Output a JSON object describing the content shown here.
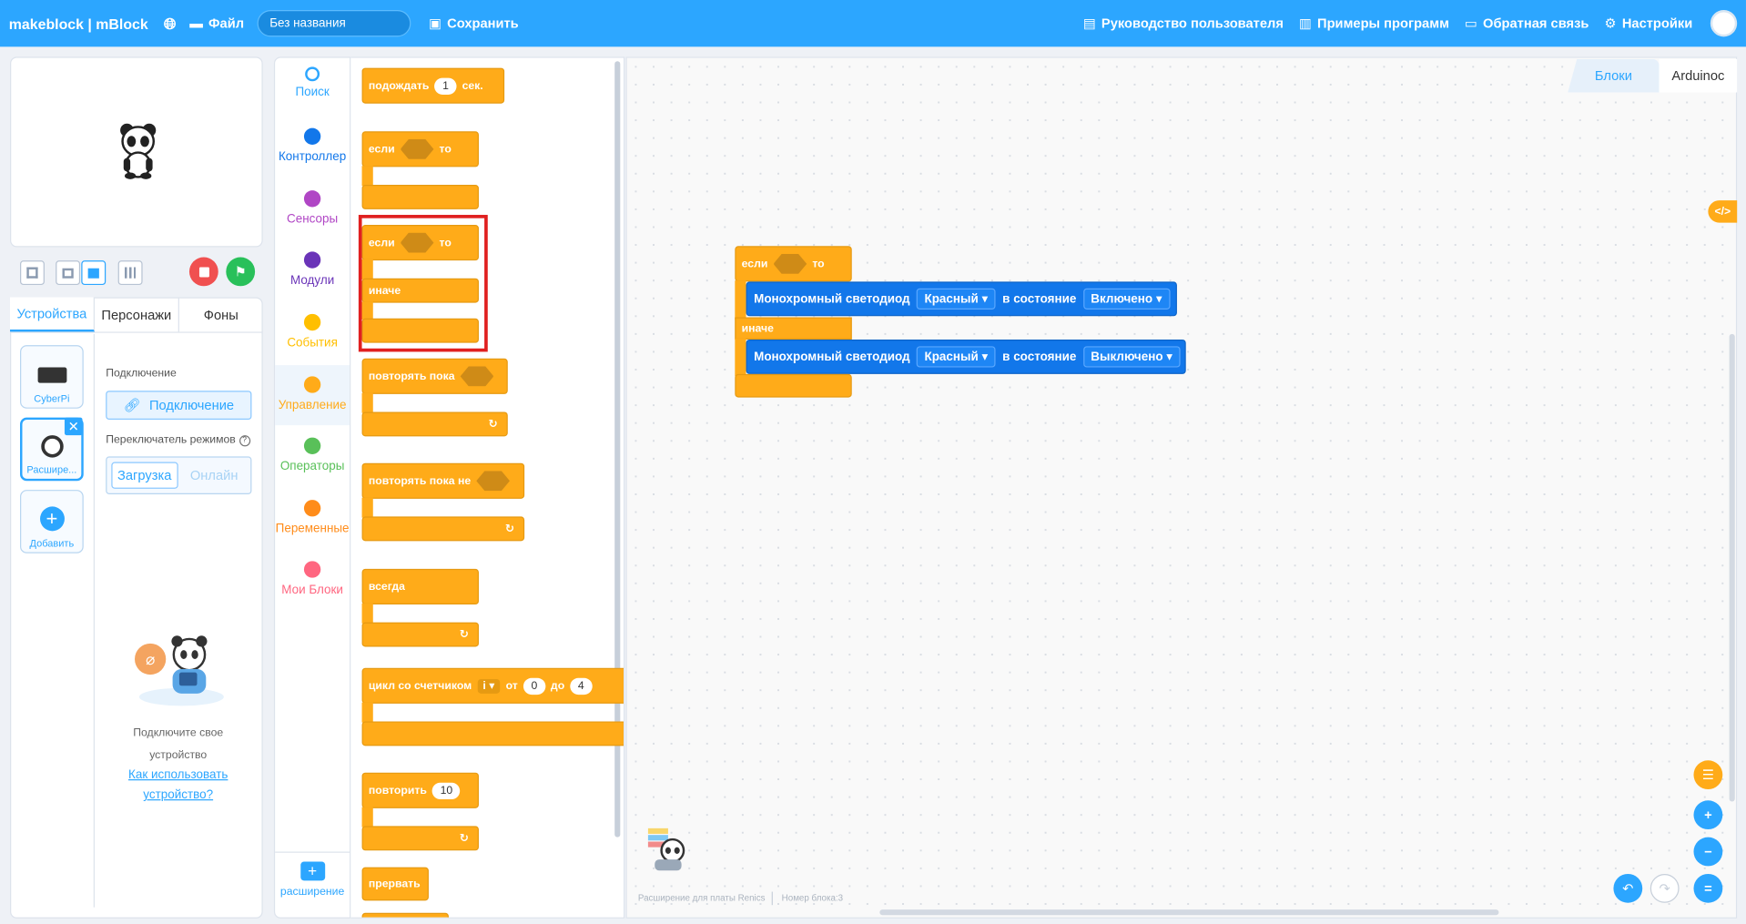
{
  "topbar": {
    "logo": "makeblock | mBlock",
    "file": "Файл",
    "title_placeholder": "Без названия",
    "save": "Сохранить",
    "manual": "Руководство пользователя",
    "examples": "Примеры программ",
    "feedback": "Обратная связь",
    "settings": "Настройки"
  },
  "stage_tabs": {
    "devices": "Устройства",
    "sprites": "Персонажи",
    "backgrounds": "Фоны"
  },
  "devices": {
    "cyberpi": "CyberPi",
    "extension": "Расшире...",
    "add": "Добавить"
  },
  "connection": {
    "heading": "Подключение",
    "connect_button": "Подключение",
    "mode_label": "Переключатель режимов",
    "upload": "Загрузка",
    "online": "Онлайн"
  },
  "hint": {
    "line1": "Подключите свое",
    "line2": "устройство",
    "link1": "Как использовать",
    "link2": "устройство?"
  },
  "categories": [
    {
      "label": "Поиск",
      "color": "#2ca6ff"
    },
    {
      "label": "Контроллер",
      "color": "#1277ea"
    },
    {
      "label": "Сенсоры",
      "color": "#b046c5"
    },
    {
      "label": "Модули",
      "color": "#6a34b8"
    },
    {
      "label": "События",
      "color": "#ffbf00"
    },
    {
      "label": "Управление",
      "color": "#ffab19"
    },
    {
      "label": "Операторы",
      "color": "#59c059"
    },
    {
      "label": "Переменные",
      "color": "#ff8c1a"
    },
    {
      "label": "Мои Блоки",
      "color": "#ff6680"
    }
  ],
  "extension_label": "расширение",
  "palette": {
    "wait": "подождать",
    "wait_value": "1",
    "wait_unit": "сек.",
    "if": "если",
    "then": "то",
    "else": "иначе",
    "repeat_until": "повторять пока",
    "repeat_until_not": "повторять пока не",
    "forever": "всегда",
    "for_loop": "цикл со счетчиком",
    "for_var": "i ▾",
    "for_from": "от",
    "for_from_val": "0",
    "for_to": "до",
    "for_to_val": "4",
    "repeat": "повторить",
    "repeat_val": "10",
    "break": "прервать"
  },
  "workspace": {
    "if": "если",
    "then": "то",
    "else": "иначе",
    "led1": {
      "label": "Монохромный светодиод",
      "color": "Красный ▾",
      "state_label": "в состояние",
      "state": "Включено ▾"
    },
    "led2": {
      "label": "Монохромный светодиод",
      "color": "Красный ▾",
      "state_label": "в состояние",
      "state": "Выключено ▾"
    }
  },
  "code_tabs": {
    "blocks": "Блоки",
    "arduino": "Arduinoc"
  },
  "status": {
    "ext": "Расширение для платы Renics",
    "block_no": "Номер блока:3"
  },
  "colors": {
    "accent": "#2ca6ff",
    "control": "#ffab19",
    "device": "#1277ea",
    "highlight": "#e02020"
  }
}
